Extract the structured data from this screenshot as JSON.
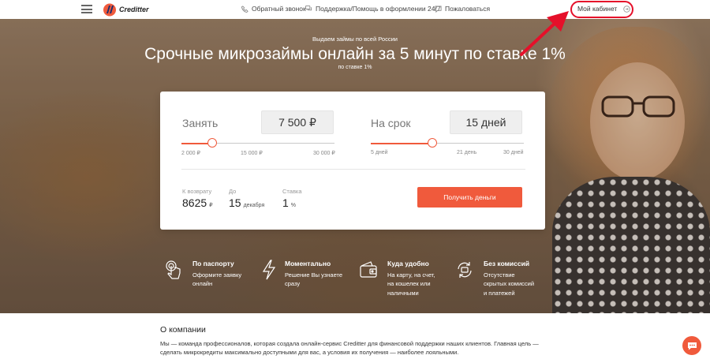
{
  "header": {
    "logo_text": "Creditter",
    "callback_label": "Обратный звонок",
    "support_label": "Поддержка/Помощь в оформлении 24/7",
    "complain_label": "Пожаловаться",
    "cabinet_label": "Мой кабинет"
  },
  "hero": {
    "subtitle": "Выдаем займы по всей России",
    "title": "Срочные микрозаймы онлайн за 5 минут по ставке 1%",
    "note": "по ставке 1%"
  },
  "calculator": {
    "amount": {
      "label": "Занять",
      "value": "7 500 ₽",
      "ticks": [
        "2 000 ₽",
        "15 000 ₽",
        "30 000 ₽"
      ],
      "slider_fraction": 0.2
    },
    "term": {
      "label": "На срок",
      "value": "15 дней",
      "ticks": [
        "5 дней",
        "21 день",
        "30 дней"
      ],
      "slider_fraction": 0.4
    },
    "repay": {
      "label": "К возврату",
      "value": "8625",
      "unit": "₽"
    },
    "until": {
      "label": "До",
      "value": "15",
      "unit": "декабря"
    },
    "rate": {
      "label": "Ставка",
      "value": "1",
      "unit": "%"
    },
    "button_label": "Получить деньги",
    "accent_color": "#f05a3c"
  },
  "features": [
    {
      "icon": "hand-pointer-icon",
      "title": "По паспорту",
      "lines": [
        "Оформите заявку",
        "онлайн"
      ]
    },
    {
      "icon": "lightning-icon",
      "title": "Моментально",
      "lines": [
        "Решение Вы узнаете",
        "сразу"
      ]
    },
    {
      "icon": "wallet-icon",
      "title": "Куда удобно",
      "lines": [
        "На карту, на счет,",
        "на кошелек или",
        "наличными"
      ]
    },
    {
      "icon": "refresh-icon",
      "title": "Без комиссий",
      "lines": [
        "Отсутствие",
        "скрытых комиссий",
        "и платежей"
      ]
    }
  ],
  "about": {
    "title": "О компании",
    "text": "Мы — команда профессионалов, которая создала онлайн-сервис Creditter для финансовой поддержки наших клиентов. Главная цель — сделать микрокредиты максимально доступными для вас, а условия их получения — наиболее лояльными."
  }
}
